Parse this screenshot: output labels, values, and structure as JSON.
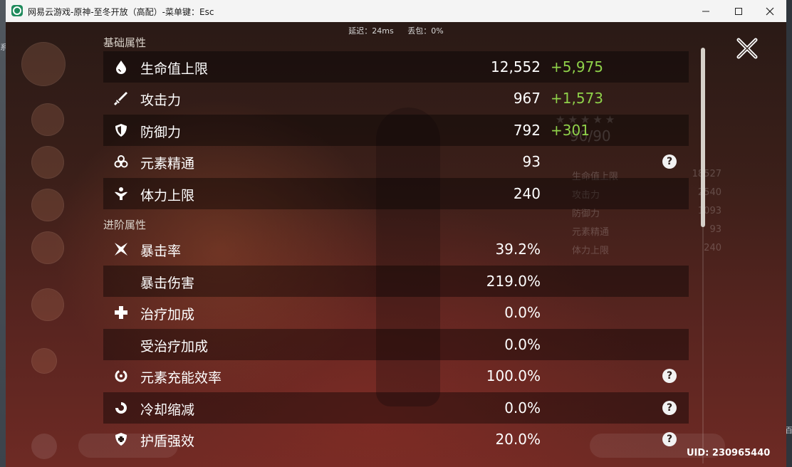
{
  "desktop": {
    "left_text": "系",
    "right_text": "百"
  },
  "window": {
    "title": "网易云游戏-原神-至冬开放（高配）-菜单键：Esc",
    "controls": {
      "minimize": "—",
      "maximize": "☐",
      "close": "✕"
    }
  },
  "netinfo": {
    "latency": "延迟：24ms",
    "packet_loss": "丢包：0%"
  },
  "sections": {
    "basic": {
      "title": "基础属性",
      "rows": [
        {
          "icon": "hp-drop-icon",
          "label": "生命值上限",
          "value": "12,552",
          "bonus": "+5,975"
        },
        {
          "icon": "sword-icon",
          "label": "攻击力",
          "value": "967",
          "bonus": "+1,573"
        },
        {
          "icon": "shield-icon",
          "label": "防御力",
          "value": "792",
          "bonus": "+301"
        },
        {
          "icon": "elemental-mastery-icon",
          "label": "元素精通",
          "value": "93",
          "help": "?"
        },
        {
          "icon": "stamina-icon",
          "label": "体力上限",
          "value": "240"
        }
      ]
    },
    "advanced": {
      "title": "进阶属性",
      "rows": [
        {
          "icon": "crit-star-icon",
          "label": "暴击率",
          "value": "39.2%"
        },
        {
          "icon": "",
          "label": "暴击伤害",
          "value": "219.0%"
        },
        {
          "icon": "heal-cross-icon",
          "label": "治疗加成",
          "value": "0.0%"
        },
        {
          "icon": "",
          "label": "受治疗加成",
          "value": "0.0%"
        },
        {
          "icon": "energy-recharge-icon",
          "label": "元素充能效率",
          "value": "100.0%",
          "help": "?"
        },
        {
          "icon": "cooldown-icon",
          "label": "冷却缩减",
          "value": "0.0%",
          "help": "?"
        },
        {
          "icon": "shield-strength-icon",
          "label": "护盾强效",
          "value": "20.0%",
          "help": "?"
        }
      ]
    }
  },
  "uid": "UID: 230965440",
  "colors": {
    "bonus": "#8fd14a",
    "text": "#ffffff",
    "section": "#d9d2c9"
  }
}
